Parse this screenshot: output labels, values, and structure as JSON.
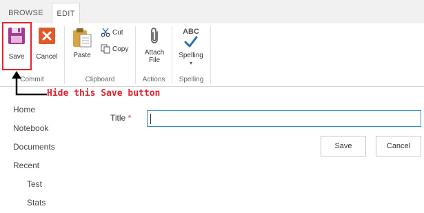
{
  "tabs": [
    {
      "label": "BROWSE"
    },
    {
      "label": "EDIT"
    }
  ],
  "ribbon": {
    "commit": {
      "save_label": "Save",
      "cancel_label": "Cancel",
      "group_label": "Commit"
    },
    "clipboard": {
      "paste_label": "Paste",
      "cut_label": "Cut",
      "copy_label": "Copy",
      "group_label": "Clipboard"
    },
    "actions": {
      "attach_line1": "Attach",
      "attach_line2": "File",
      "group_label": "Actions"
    },
    "spelling": {
      "abc": "ABC",
      "spelling_label": "Spelling",
      "group_label": "Spelling"
    }
  },
  "annotation": {
    "text": "Hide this Save button",
    "color": "#e2222d"
  },
  "nav": {
    "items": [
      {
        "label": "Home"
      },
      {
        "label": "Notebook"
      },
      {
        "label": "Documents"
      },
      {
        "label": "Recent"
      },
      {
        "label": "Test"
      },
      {
        "label": "Stats"
      }
    ]
  },
  "form": {
    "title_label": "Title",
    "required_marker": "*",
    "title_value": "",
    "save_label": "Save",
    "cancel_label": "Cancel"
  },
  "colors": {
    "accent": "#2a8dd4",
    "save_icon": "#a33b96",
    "cancel_icon": "#e05a2b",
    "annotation": "#e2222d"
  }
}
